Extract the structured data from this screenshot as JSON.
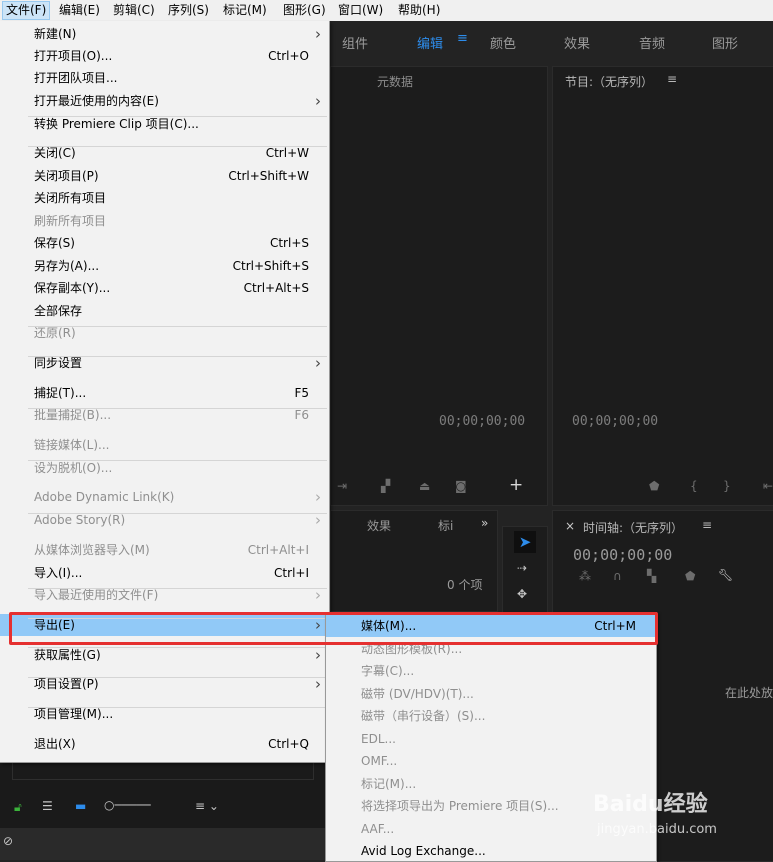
{
  "menubar": {
    "items": [
      "文件(F)",
      "编辑(E)",
      "剪辑(C)",
      "序列(S)",
      "标记(M)",
      "图形(G)",
      "窗口(W)",
      "帮助(H)"
    ]
  },
  "workspace_tabs": [
    "组件",
    "编辑",
    "颜色",
    "效果",
    "音频",
    "图形"
  ],
  "workspace_active": "编辑",
  "panels": {
    "metadata_title": "元数据",
    "program_title": "节目:（无序列）",
    "source_timecode": "00;00;00;00",
    "program_timecode": "00;00;00;00",
    "effects_tab": "效果",
    "markers_tab": "标i",
    "item_count": "0 个项",
    "timeline_title": "时间轴:（无序列）",
    "timeline_timecode": "00;00;00;00",
    "drop_hint": "在此处放"
  },
  "file_menu": [
    {
      "label": "新建(N)",
      "shortcut": "",
      "arrow": true,
      "disabled": false
    },
    {
      "label": "打开项目(O)...",
      "shortcut": "Ctrl+O",
      "arrow": false,
      "disabled": false
    },
    {
      "label": "打开团队项目...",
      "shortcut": "",
      "arrow": false,
      "disabled": false
    },
    {
      "label": "打开最近使用的内容(E)",
      "shortcut": "",
      "arrow": true,
      "disabled": false
    },
    {
      "label": "转换 Premiere Clip 项目(C)...",
      "shortcut": "",
      "arrow": false,
      "disabled": false
    },
    {
      "label": "关闭(C)",
      "shortcut": "Ctrl+W",
      "arrow": false,
      "disabled": false
    },
    {
      "label": "关闭项目(P)",
      "shortcut": "Ctrl+Shift+W",
      "arrow": false,
      "disabled": false
    },
    {
      "label": "关闭所有项目",
      "shortcut": "",
      "arrow": false,
      "disabled": false
    },
    {
      "label": "刷新所有项目",
      "shortcut": "",
      "arrow": false,
      "disabled": true
    },
    {
      "label": "保存(S)",
      "shortcut": "Ctrl+S",
      "arrow": false,
      "disabled": false
    },
    {
      "label": "另存为(A)...",
      "shortcut": "Ctrl+Shift+S",
      "arrow": false,
      "disabled": false
    },
    {
      "label": "保存副本(Y)...",
      "shortcut": "Ctrl+Alt+S",
      "arrow": false,
      "disabled": false
    },
    {
      "label": "全部保存",
      "shortcut": "",
      "arrow": false,
      "disabled": false
    },
    {
      "label": "还原(R)",
      "shortcut": "",
      "arrow": false,
      "disabled": true
    },
    {
      "label": "同步设置",
      "shortcut": "",
      "arrow": true,
      "disabled": false
    },
    {
      "label": "捕捉(T)...",
      "shortcut": "F5",
      "arrow": false,
      "disabled": false
    },
    {
      "label": "批量捕捉(B)...",
      "shortcut": "F6",
      "arrow": false,
      "disabled": true
    },
    {
      "label": "链接媒体(L)...",
      "shortcut": "",
      "arrow": false,
      "disabled": true
    },
    {
      "label": "设为脱机(O)...",
      "shortcut": "",
      "arrow": false,
      "disabled": true
    },
    {
      "label": "Adobe Dynamic Link(K)",
      "shortcut": "",
      "arrow": true,
      "disabled": true
    },
    {
      "label": "Adobe Story(R)",
      "shortcut": "",
      "arrow": true,
      "disabled": true
    },
    {
      "label": "从媒体浏览器导入(M)",
      "shortcut": "Ctrl+Alt+I",
      "arrow": false,
      "disabled": true
    },
    {
      "label": "导入(I)...",
      "shortcut": "Ctrl+I",
      "arrow": false,
      "disabled": false
    },
    {
      "label": "导入最近使用的文件(F)",
      "shortcut": "",
      "arrow": true,
      "disabled": true
    },
    {
      "label": "导出(E)",
      "shortcut": "",
      "arrow": true,
      "disabled": false,
      "highlighted": true
    },
    {
      "label": "获取属性(G)",
      "shortcut": "",
      "arrow": true,
      "disabled": false
    },
    {
      "label": "项目设置(P)",
      "shortcut": "",
      "arrow": true,
      "disabled": false
    },
    {
      "label": "项目管理(M)...",
      "shortcut": "",
      "arrow": false,
      "disabled": false
    },
    {
      "label": "退出(X)",
      "shortcut": "Ctrl+Q",
      "arrow": false,
      "disabled": false
    }
  ],
  "export_submenu": [
    {
      "label": "媒体(M)...",
      "shortcut": "Ctrl+M",
      "disabled": false,
      "highlighted": true
    },
    {
      "label": "动态图形模板(R)...",
      "shortcut": "",
      "disabled": true
    },
    {
      "label": "字幕(C)...",
      "shortcut": "",
      "disabled": true
    },
    {
      "label": "磁带 (DV/HDV)(T)...",
      "shortcut": "",
      "disabled": true
    },
    {
      "label": "磁带（串行设备）(S)...",
      "shortcut": "",
      "disabled": true
    },
    {
      "label": "EDL...",
      "shortcut": "",
      "disabled": true
    },
    {
      "label": "OMF...",
      "shortcut": "",
      "disabled": true
    },
    {
      "label": "标记(M)...",
      "shortcut": "",
      "disabled": true
    },
    {
      "label": "将选择项导出为 Premiere 项目(S)...",
      "shortcut": "",
      "disabled": true
    },
    {
      "label": "AAF...",
      "shortcut": "",
      "disabled": true
    },
    {
      "label": "Avid Log Exchange...",
      "shortcut": "",
      "disabled": false
    }
  ],
  "watermark": {
    "brand": "Baidu经验",
    "url": "jingyan.baidu.com"
  },
  "colors": {
    "accent": "#2d8ceb",
    "highlight": "#91c9f7",
    "annotation": "#e53030"
  }
}
